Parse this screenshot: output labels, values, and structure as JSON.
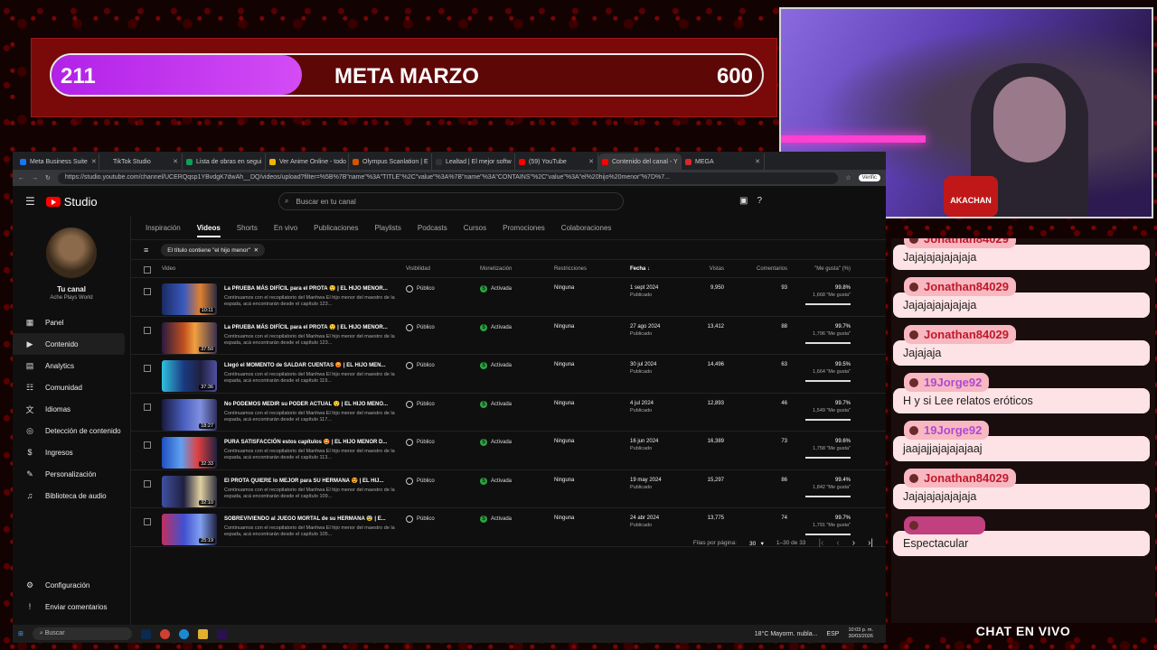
{
  "goal": {
    "current": "211",
    "title": "META MARZO",
    "target": "600",
    "progress": 0.352
  },
  "browser": {
    "tabs": [
      {
        "label": "Meta Business Suite",
        "color": "#1877f2"
      },
      {
        "label": "TikTok Studio",
        "color": "#222222"
      },
      {
        "label": "Lista de obras en segui",
        "color": "#0f9d58"
      },
      {
        "label": "Ver Anime Online - todo",
        "color": "#f4b400"
      },
      {
        "label": "Olympus Scanlation | E",
        "color": "#d35400"
      },
      {
        "label": "Lealtad | El mejor softw",
        "color": "#333333"
      },
      {
        "label": "(59) YouTube",
        "color": "#ff0000"
      },
      {
        "label": "Contenido del canal - Y",
        "color": "#ff0000"
      },
      {
        "label": "MEGA",
        "color": "#d9272e"
      }
    ],
    "url": "https://studio.youtube.com/channel/UCERQqsp1YBvdgK7dwAh__DQ/videos/upload?filter=%5B%7B\"name\"%3A\"TITLE\"%2C\"value\"%3A%7B\"name\"%3A\"CONTAINS\"%2C\"value\"%3A\"el%20hijo%20menor\"%7D%7...",
    "verify": "Verific"
  },
  "studio": {
    "brand": "Studio",
    "search_placeholder": "Buscar en tu canal",
    "channel_name": "Tu canal",
    "channel_handle": "Ache Plays World",
    "nav": [
      {
        "label": "Panel",
        "icon": "dashboard-icon",
        "glyph": "▦"
      },
      {
        "label": "Contenido",
        "icon": "content-icon",
        "glyph": "▶"
      },
      {
        "label": "Analytics",
        "icon": "analytics-icon",
        "glyph": "▤"
      },
      {
        "label": "Comunidad",
        "icon": "community-icon",
        "glyph": "☷"
      },
      {
        "label": "Idiomas",
        "icon": "languages-icon",
        "glyph": "文"
      },
      {
        "label": "Detección de contenido",
        "icon": "content-detection-icon",
        "glyph": "◎"
      },
      {
        "label": "Ingresos",
        "icon": "earn-icon",
        "glyph": "$"
      },
      {
        "label": "Personalización",
        "icon": "customization-icon",
        "glyph": "✎"
      },
      {
        "label": "Biblioteca de audio",
        "icon": "audio-library-icon",
        "glyph": "♫"
      }
    ],
    "nav_bottom": [
      {
        "label": "Configuración",
        "icon": "settings-icon",
        "glyph": "⚙"
      },
      {
        "label": "Enviar comentarios",
        "icon": "feedback-icon",
        "glyph": "!"
      }
    ],
    "tabs": [
      "Inspiración",
      "Videos",
      "Shorts",
      "En vivo",
      "Publicaciones",
      "Playlists",
      "Podcasts",
      "Cursos",
      "Promociones",
      "Colaboraciones"
    ],
    "filter_chip": "El título contiene \"el hijo menor\"",
    "columns": {
      "video": "Video",
      "visibility": "Visibilidad",
      "monetization": "Monetización",
      "restrictions": "Restricciones",
      "date": "Fecha",
      "views": "Vistas",
      "comments": "Comentarios",
      "likes": "\"Me gusta\" (%)"
    },
    "rows": [
      {
        "title": "La PRUEBA MÁS DIFÍCIL para el PROTA 😲 | EL HIJO MENOR...",
        "desc": "Continuamos con el recopilatorio del Manhwa El hijo menor del maestro de la espada, acá encontrarán desde el capítulo 123...",
        "duration": "10:11",
        "visibility": "Público",
        "monetization": "Activada",
        "restrictions": "Ninguna",
        "date": "1 sept 2024",
        "status": "Publicado",
        "views": "9,950",
        "comments": "93",
        "likes_pct": "99.8%",
        "likes_count": "1,668 \"Me gusta\"",
        "like_ratio": 0.998
      },
      {
        "title": "La PRUEBA MÁS DIFÍCIL para el PROTA 😲 | EL HIJO MENOR...",
        "desc": "Continuamos con el recopilatorio del Manhwa El hijo menor del maestro de la espada, acá encontrarán desde el capítulo 123...",
        "duration": "37:50",
        "visibility": "Público",
        "monetization": "Activada",
        "restrictions": "Ninguna",
        "date": "27 ago 2024",
        "status": "Publicado",
        "views": "13,412",
        "comments": "88",
        "likes_pct": "99.7%",
        "likes_count": "1,796 \"Me gusta\"",
        "like_ratio": 0.997
      },
      {
        "title": "Llegó el MOMENTO de SALDAR CUENTAS 😡 | EL HIJO MEN...",
        "desc": "Continuamos con el recopilatorio del Manhwa El hijo menor del maestro de la espada, acá encontrarán desde el capítulo 119...",
        "duration": "37:36",
        "visibility": "Público",
        "monetization": "Activada",
        "restrictions": "Ninguna",
        "date": "30 jul 2024",
        "status": "Publicado",
        "views": "14,496",
        "comments": "63",
        "likes_pct": "99.5%",
        "likes_count": "1,664 \"Me gusta\"",
        "like_ratio": 0.995
      },
      {
        "title": "No PODEMOS MEDIR su PODER ACTUAL 😲 | EL HIJO MENO...",
        "desc": "Continuamos con el recopilatorio del Manhwa El hijo menor del maestro de la espada, acá encontrarán desde el capítulo 117...",
        "duration": "18:27",
        "visibility": "Público",
        "monetization": "Activada",
        "restrictions": "Ninguna",
        "date": "4 jul 2024",
        "status": "Publicado",
        "views": "12,893",
        "comments": "46",
        "likes_pct": "99.7%",
        "likes_count": "1,549 \"Me gusta\"",
        "like_ratio": 0.997
      },
      {
        "title": "PURA SATISFACCIÓN estos capítulos 🤩 | EL HIJO MENOR D...",
        "desc": "Continuamos con el recopilatorio del Manhwa El hijo menor del maestro de la espada, acá encontrarán desde el capítulo 113...",
        "duration": "32:33",
        "visibility": "Público",
        "monetization": "Activada",
        "restrictions": "Ninguna",
        "date": "16 jun 2024",
        "status": "Publicado",
        "views": "16,389",
        "comments": "73",
        "likes_pct": "99.6%",
        "likes_count": "1,758 \"Me gusta\"",
        "like_ratio": 0.996
      },
      {
        "title": "El PROTA QUIERE lo MEJOR para SU HERMANA 😍 | EL HIJ...",
        "desc": "Continuamos con el recopilatorio del Manhwa El hijo menor del maestro de la espada, acá encontrarán desde el capítulo 109...",
        "duration": "32:10",
        "visibility": "Público",
        "monetization": "Activada",
        "restrictions": "Ninguna",
        "date": "19 may 2024",
        "status": "Publicado",
        "views": "15,297",
        "comments": "86",
        "likes_pct": "99.4%",
        "likes_count": "1,842 \"Me gusta\"",
        "like_ratio": 0.994
      },
      {
        "title": "SOBREVIVIENDO al JUEGO MORTAL de su HERMANA 😨 | E...",
        "desc": "Continuamos con el recopilatorio del Manhwa El hijo menor del maestro de la espada, acá encontrarán desde el capítulo 105...",
        "duration": "25:19",
        "visibility": "Público",
        "monetization": "Activada",
        "restrictions": "Ninguna",
        "date": "24 abr 2024",
        "status": "Publicado",
        "views": "13,775",
        "comments": "74",
        "likes_pct": "99.7%",
        "likes_count": "1,791 \"Me gusta\"",
        "like_ratio": 0.997
      }
    ],
    "pager": {
      "rows_label": "Filas por página:",
      "rows_value": "30",
      "range": "1–30 de 33"
    }
  },
  "taskbar": {
    "search": "Buscar",
    "weather": "18°C  Mayorm. nubla...",
    "lang": "ESP",
    "time": "10:03 p. m.",
    "date": "30/03/2026"
  },
  "chat": {
    "messages": [
      {
        "user": "Jonathan84029",
        "text": "Jajajajajajajaja"
      },
      {
        "user": "Jonathan84029",
        "text": "Jajajajajajajaja"
      },
      {
        "user": "Jonathan84029",
        "text": "Jajajaja"
      },
      {
        "user": "19Jorge92",
        "text": "H y si Lee relatos eróticos"
      },
      {
        "user": "19Jorge92",
        "text": "jaajajjajajajajaaj"
      },
      {
        "user": "Jonathan84029",
        "text": "Jajajajajajajaja"
      },
      {
        "user": "",
        "text": "Espectacular"
      }
    ],
    "footer": "CHAT EN VIVO"
  },
  "webcam": {
    "logo_text": "AKACHAN"
  }
}
